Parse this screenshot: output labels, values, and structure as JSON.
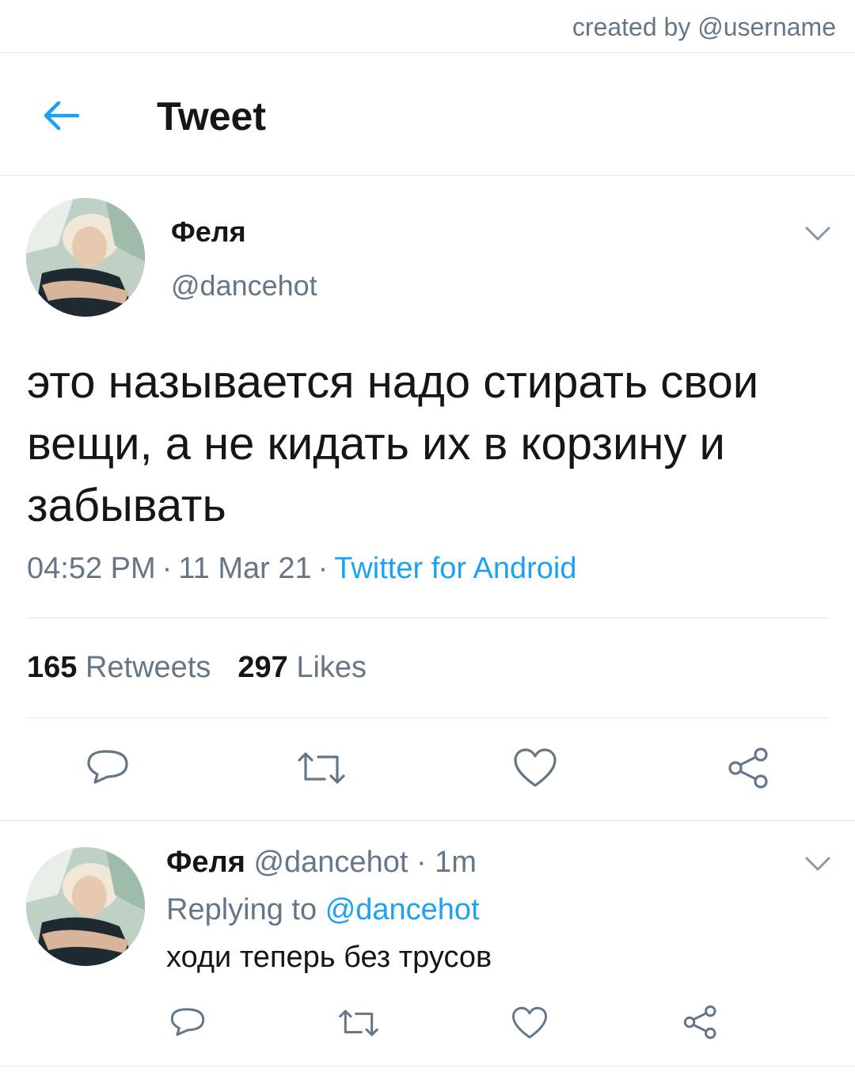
{
  "watermark": "created by @username",
  "header": {
    "title": "Tweet"
  },
  "tweet": {
    "display_name": "Феля",
    "handle": "@dancehot",
    "text": "это называется надо стирать свои вещи, а не кидать их в корзину и забывать",
    "time": "04:52 PM",
    "date": "11 Mar 21",
    "separator": "·",
    "source": "Twitter for Android",
    "retweets_count": "165",
    "retweets_label": "Retweets",
    "likes_count": "297",
    "likes_label": "Likes"
  },
  "reply": {
    "display_name": "Феля",
    "handle": "@dancehot",
    "separator": "·",
    "age": "1m",
    "replying_prefix": "Replying to",
    "replying_to": "@dancehot",
    "text": "ходи теперь без трусов"
  },
  "colors": {
    "accent": "#1da1f2",
    "secondary_text": "#657786",
    "icon": "#657786",
    "divider": "#e1e8ed"
  },
  "icons": [
    "back-arrow-icon",
    "chevron-down-icon",
    "reply-icon",
    "retweet-icon",
    "like-icon",
    "share-icon"
  ]
}
